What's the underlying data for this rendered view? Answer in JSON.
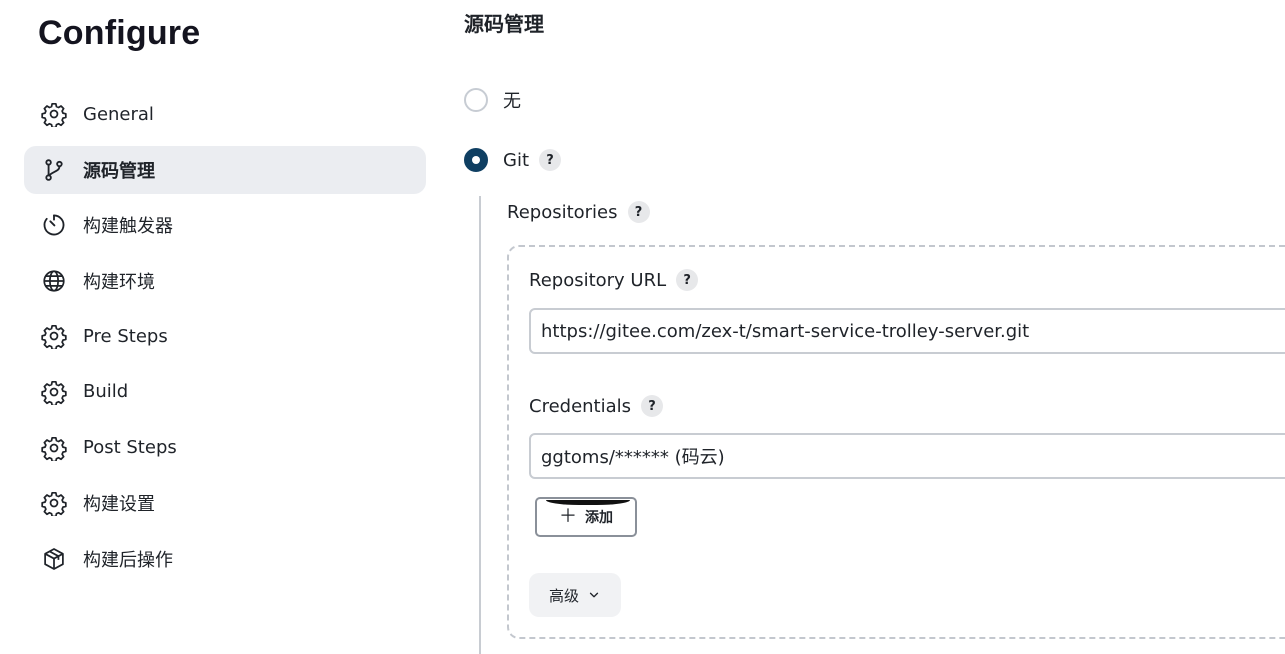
{
  "sidebar": {
    "title": "Configure",
    "items": [
      {
        "label": "General",
        "icon": "gear-icon",
        "active": false
      },
      {
        "label": "源码管理",
        "icon": "git-branch-icon",
        "active": true
      },
      {
        "label": "构建触发器",
        "icon": "timer-icon",
        "active": false
      },
      {
        "label": "构建环境",
        "icon": "globe-icon",
        "active": false
      },
      {
        "label": "Pre Steps",
        "icon": "gear-icon",
        "active": false
      },
      {
        "label": "Build",
        "icon": "gear-icon",
        "active": false
      },
      {
        "label": "Post Steps",
        "icon": "gear-icon",
        "active": false
      },
      {
        "label": "构建设置",
        "icon": "gear-icon",
        "active": false
      },
      {
        "label": "构建后操作",
        "icon": "package-icon",
        "active": false
      }
    ]
  },
  "scm": {
    "title": "源码管理",
    "options": [
      {
        "label": "无",
        "checked": false
      },
      {
        "label": "Git",
        "checked": true
      }
    ],
    "help_glyph": "?",
    "repositories_label": "Repositories",
    "repository_url_label": "Repository URL",
    "repository_url_value": "https://gitee.com/zex-t/smart-service-trolley-server.git",
    "credentials_label": "Credentials",
    "credentials_value": "ggtoms/****** (码云)",
    "add_label": "添加",
    "add_icon": "plus-icon",
    "advanced_label": "高级",
    "advanced_icon": "chevron-down-icon"
  },
  "colors": {
    "accent": "#0f3f62",
    "active_nav_bg": "#ebedf1",
    "help_bg": "#e7e8ea"
  }
}
